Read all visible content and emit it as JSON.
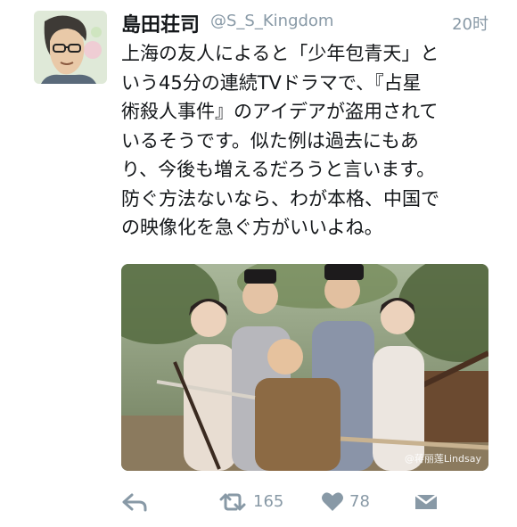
{
  "tweet": {
    "display_name": "島田荘司",
    "handle": "@S_S_Kingdom",
    "timestamp": "20时",
    "text_lines": [
      "上海の友人によると「少年包青天」と",
      "いう45分の連続TVドラマで、『占星",
      "術殺人事件』のアイデアが盗用されて",
      "いるそうです。似た例は過去にもあ",
      "り、今後も増えるだろうと言います。",
      "防ぐ方法ないなら、わが本格、中国で",
      "の映像化を急ぐ方がいいよね。"
    ],
    "media_watermark": "@蒋丽莲Lindsay"
  },
  "actions": {
    "reply": {
      "icon": "reply-icon"
    },
    "retweet": {
      "icon": "retweet-icon",
      "count": "165"
    },
    "like": {
      "icon": "heart-icon",
      "count": "78"
    },
    "message": {
      "icon": "direct-message-icon"
    }
  },
  "colors": {
    "text": "#14171a",
    "muted": "#8899a6",
    "background": "#ffffff"
  }
}
